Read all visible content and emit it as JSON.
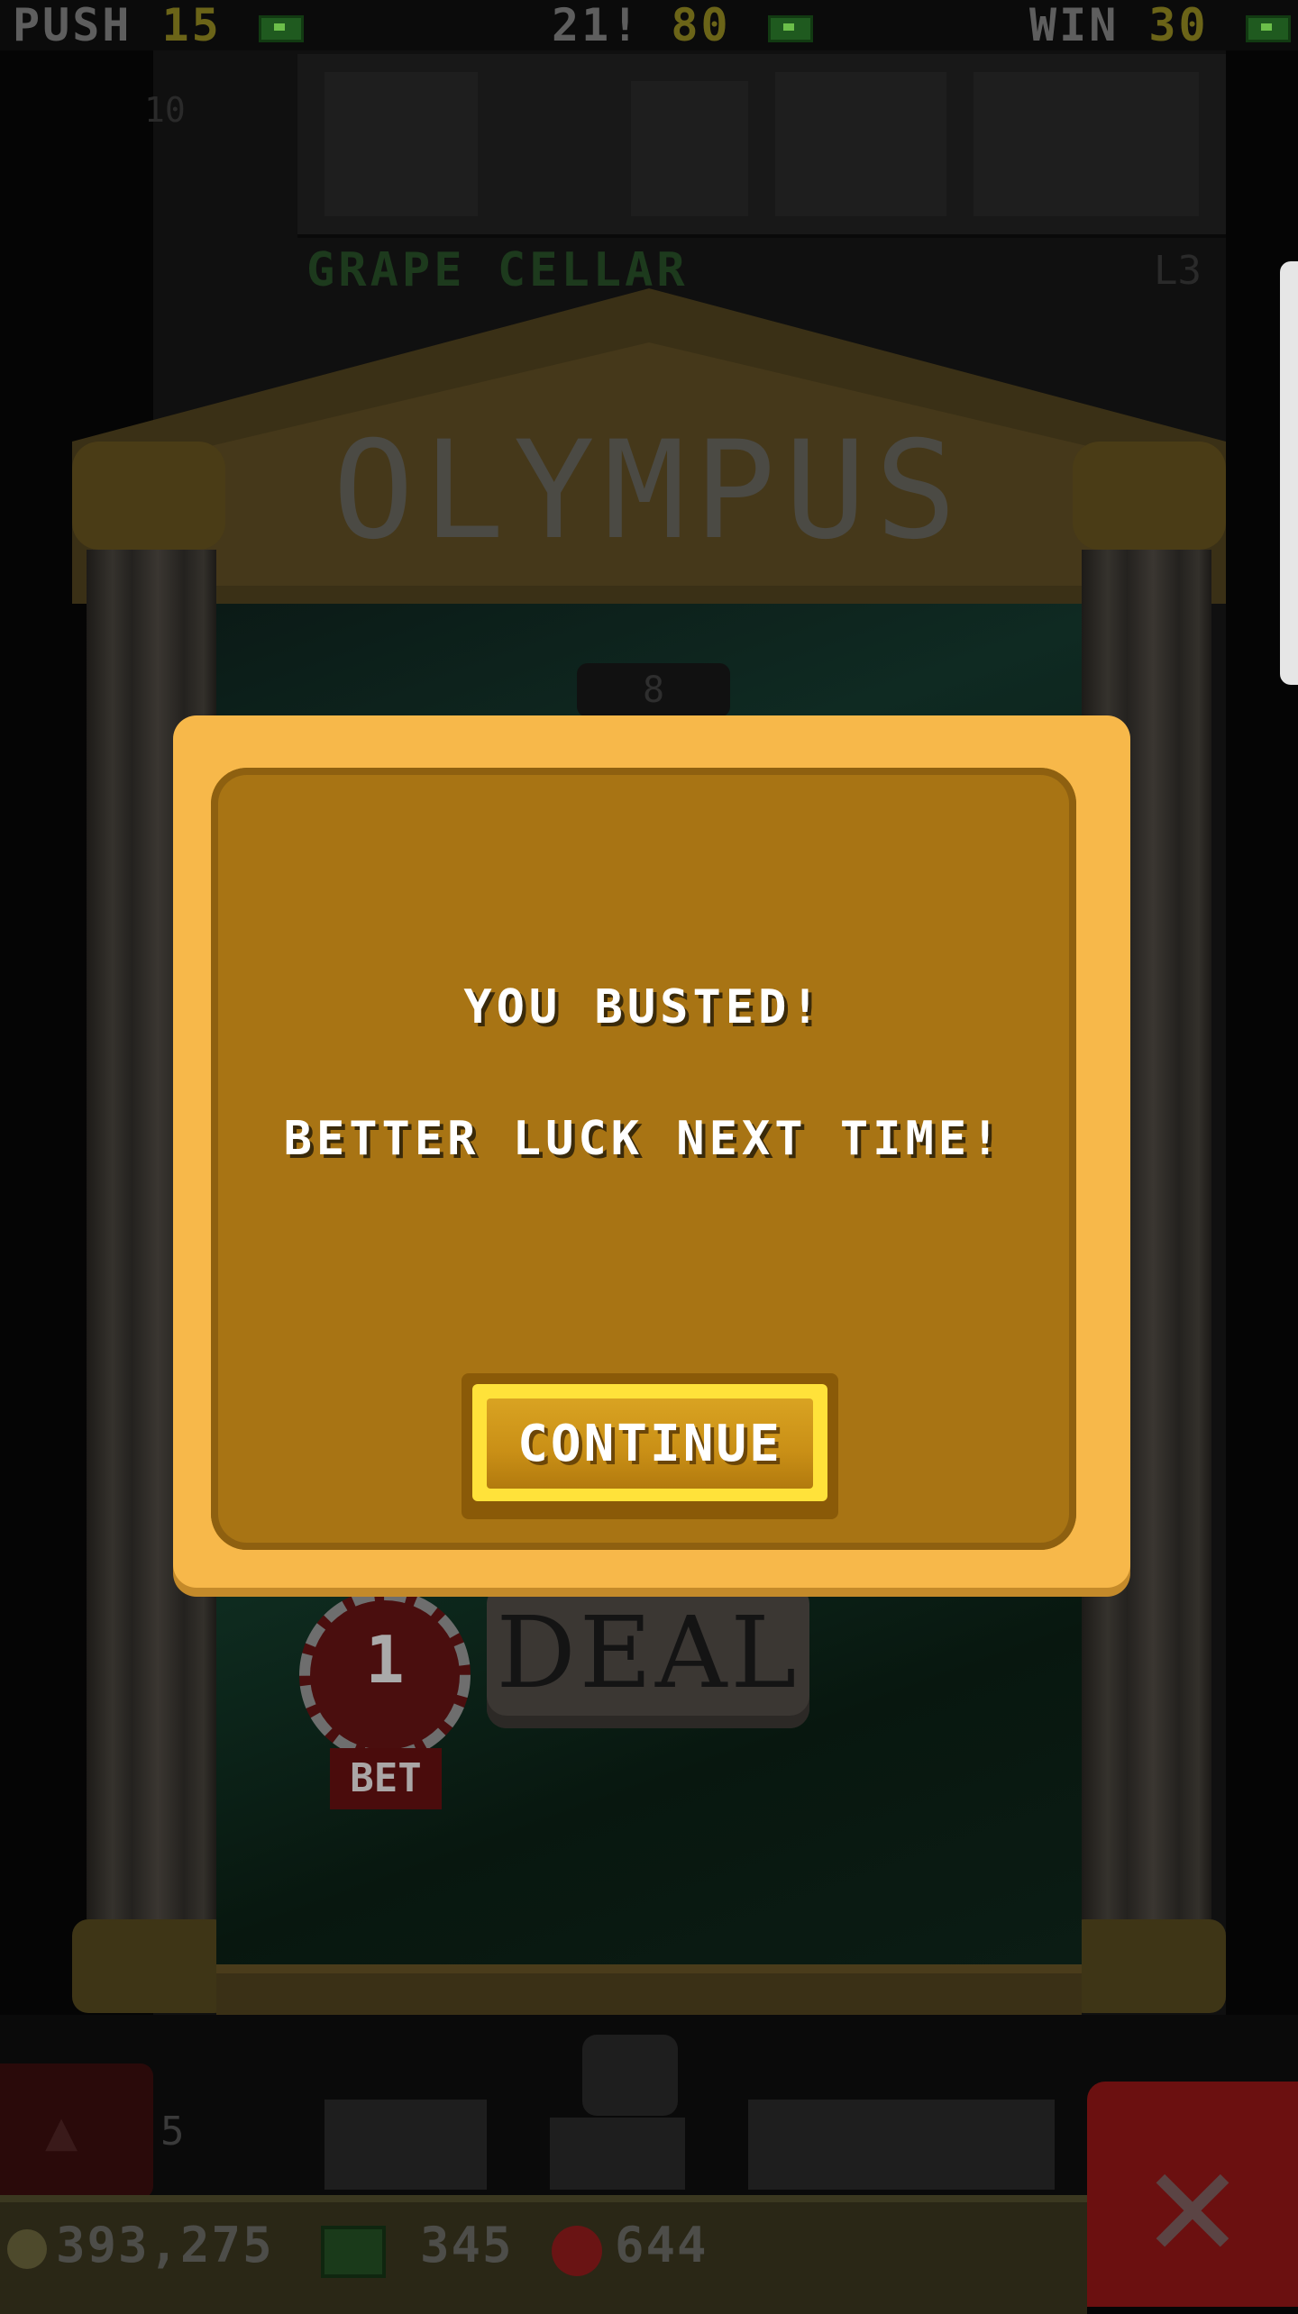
{
  "payouts": {
    "push": {
      "label": "PUSH",
      "value": "15"
    },
    "blackjack": {
      "label": "21!",
      "value": "80"
    },
    "win": {
      "label": "WIN",
      "value": "30"
    }
  },
  "tower": {
    "floor_name": "GRAPE CELLAR",
    "floor_number": "10",
    "level": "L3"
  },
  "table": {
    "sign": "OLYMPUS",
    "shoe_count": "8",
    "chip_value": "1",
    "bet_label": "BET",
    "deal_label": "DEAL"
  },
  "dialog": {
    "line1": "YOU BUSTED!",
    "line2": "BETTER LUCK NEXT TIME!",
    "button_label": "CONTINUE"
  },
  "resources": {
    "coins": "393,275",
    "bux": "345",
    "gems": "644"
  },
  "lobby_count": "5",
  "icons": {
    "bux": "bux-icon",
    "coin": "coin-icon",
    "gem": "gem-icon",
    "close": "close-icon",
    "elevator": "elevator-icon"
  },
  "colors": {
    "dialog_frame": "#f7b84a",
    "dialog_fill": "#a87414",
    "button_highlight": "#ffe23a",
    "dim_overlay": "#050505"
  }
}
